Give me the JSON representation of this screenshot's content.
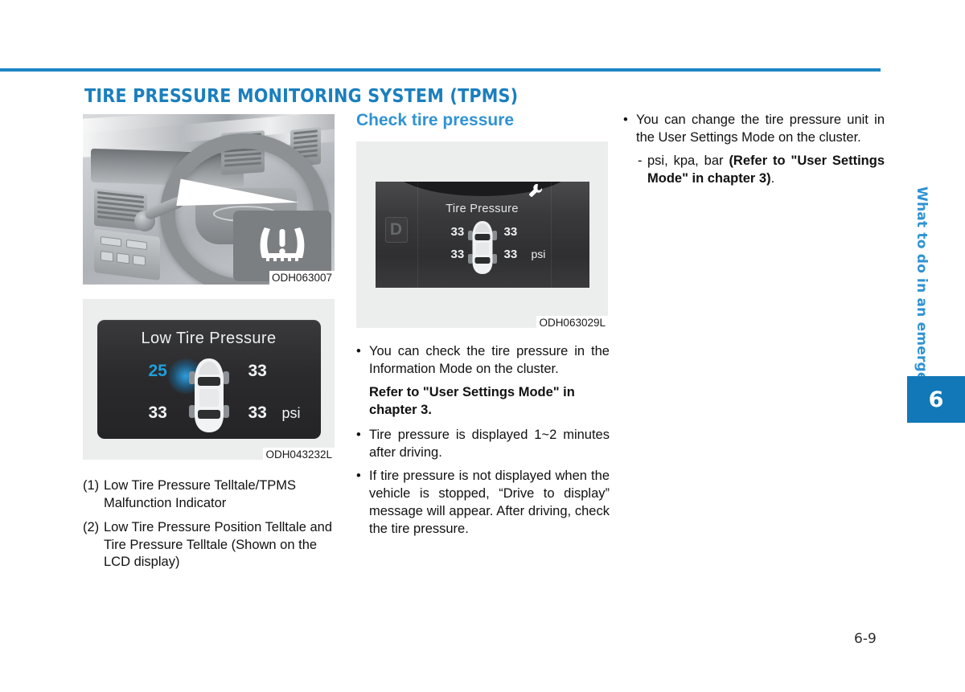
{
  "page": {
    "number": "6-9",
    "chapter_number": "6",
    "chapter_tab_label": "What to do in an emergency",
    "accent_color": "#1f86c4",
    "heading_color": "#2f93d4",
    "tab_color": "#1278b8"
  },
  "section": {
    "title": "TIRE PRESSURE MONITORING SYSTEM (TPMS)"
  },
  "column1": {
    "figure1": {
      "caption": "ODH063007",
      "telltale_icon": "tire-pressure-warning-icon"
    },
    "figure2": {
      "caption": "ODH043232L",
      "display_title": "Low Tire Pressure",
      "values": {
        "front_left": "25",
        "front_right": "33",
        "rear_left": "33",
        "rear_right": "33"
      },
      "unit": "psi",
      "alert_color": "#1e9fdc"
    },
    "legend": [
      {
        "num": "(1)",
        "text": "Low Tire Pressure Telltale/TPMS Malfunction Indicator"
      },
      {
        "num": "(2)",
        "text": "Low Tire Pressure Position Telltale and Tire Pressure Telltale (Shown on the LCD display)"
      }
    ]
  },
  "column2": {
    "heading": "Check tire pressure",
    "figure3": {
      "caption": "ODH063029L",
      "display_title": "Tire Pressure",
      "gear_indicator": "D",
      "service_icon": "wrench-icon",
      "values": {
        "front_left": "33",
        "front_right": "33",
        "rear_left": "33",
        "rear_right": "33"
      },
      "unit": "psi"
    },
    "bullets": [
      {
        "marker": "•",
        "text": "You can check the tire pressure in the Information Mode on the cluster.",
        "emphasis": "Refer to \"User Settings Mode\" in chapter 3."
      },
      {
        "marker": "•",
        "text": "Tire pressure is displayed 1~2 minutes after driving.",
        "emphasis": ""
      },
      {
        "marker": "•",
        "text": "If tire pressure is not displayed when the vehicle is stopped, “Drive to display” message will appear. After driving, check the tire pressure.",
        "emphasis": ""
      }
    ]
  },
  "column3": {
    "bullets": [
      {
        "marker": "•",
        "text": "You can change the tire pressure unit in the User Settings Mode on the cluster."
      }
    ],
    "sub_bullet": {
      "marker": "-",
      "text": "psi, kpa, bar ",
      "emphasis": "(Refer to \"User Settings Mode\" in chapter 3)",
      "tail": "."
    }
  }
}
